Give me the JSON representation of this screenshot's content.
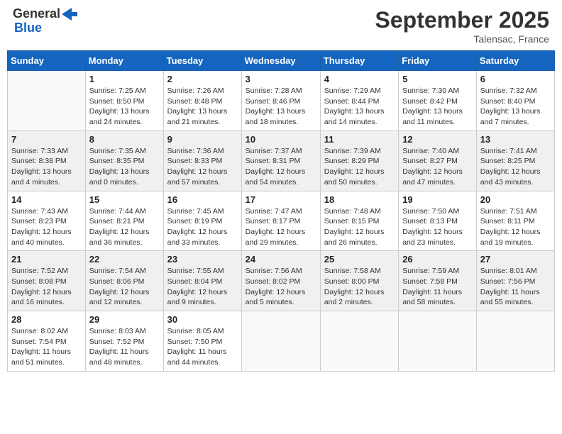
{
  "header": {
    "logo_general": "General",
    "logo_blue": "Blue",
    "title": "September 2025",
    "location": "Talensac, France"
  },
  "days_of_week": [
    "Sunday",
    "Monday",
    "Tuesday",
    "Wednesday",
    "Thursday",
    "Friday",
    "Saturday"
  ],
  "weeks": [
    [
      {
        "day": "",
        "info": ""
      },
      {
        "day": "1",
        "info": "Sunrise: 7:25 AM\nSunset: 8:50 PM\nDaylight: 13 hours\nand 24 minutes."
      },
      {
        "day": "2",
        "info": "Sunrise: 7:26 AM\nSunset: 8:48 PM\nDaylight: 13 hours\nand 21 minutes."
      },
      {
        "day": "3",
        "info": "Sunrise: 7:28 AM\nSunset: 8:46 PM\nDaylight: 13 hours\nand 18 minutes."
      },
      {
        "day": "4",
        "info": "Sunrise: 7:29 AM\nSunset: 8:44 PM\nDaylight: 13 hours\nand 14 minutes."
      },
      {
        "day": "5",
        "info": "Sunrise: 7:30 AM\nSunset: 8:42 PM\nDaylight: 13 hours\nand 11 minutes."
      },
      {
        "day": "6",
        "info": "Sunrise: 7:32 AM\nSunset: 8:40 PM\nDaylight: 13 hours\nand 7 minutes."
      }
    ],
    [
      {
        "day": "7",
        "info": "Sunrise: 7:33 AM\nSunset: 8:38 PM\nDaylight: 13 hours\nand 4 minutes."
      },
      {
        "day": "8",
        "info": "Sunrise: 7:35 AM\nSunset: 8:35 PM\nDaylight: 13 hours\nand 0 minutes."
      },
      {
        "day": "9",
        "info": "Sunrise: 7:36 AM\nSunset: 8:33 PM\nDaylight: 12 hours\nand 57 minutes."
      },
      {
        "day": "10",
        "info": "Sunrise: 7:37 AM\nSunset: 8:31 PM\nDaylight: 12 hours\nand 54 minutes."
      },
      {
        "day": "11",
        "info": "Sunrise: 7:39 AM\nSunset: 8:29 PM\nDaylight: 12 hours\nand 50 minutes."
      },
      {
        "day": "12",
        "info": "Sunrise: 7:40 AM\nSunset: 8:27 PM\nDaylight: 12 hours\nand 47 minutes."
      },
      {
        "day": "13",
        "info": "Sunrise: 7:41 AM\nSunset: 8:25 PM\nDaylight: 12 hours\nand 43 minutes."
      }
    ],
    [
      {
        "day": "14",
        "info": "Sunrise: 7:43 AM\nSunset: 8:23 PM\nDaylight: 12 hours\nand 40 minutes."
      },
      {
        "day": "15",
        "info": "Sunrise: 7:44 AM\nSunset: 8:21 PM\nDaylight: 12 hours\nand 36 minutes."
      },
      {
        "day": "16",
        "info": "Sunrise: 7:45 AM\nSunset: 8:19 PM\nDaylight: 12 hours\nand 33 minutes."
      },
      {
        "day": "17",
        "info": "Sunrise: 7:47 AM\nSunset: 8:17 PM\nDaylight: 12 hours\nand 29 minutes."
      },
      {
        "day": "18",
        "info": "Sunrise: 7:48 AM\nSunset: 8:15 PM\nDaylight: 12 hours\nand 26 minutes."
      },
      {
        "day": "19",
        "info": "Sunrise: 7:50 AM\nSunset: 8:13 PM\nDaylight: 12 hours\nand 23 minutes."
      },
      {
        "day": "20",
        "info": "Sunrise: 7:51 AM\nSunset: 8:11 PM\nDaylight: 12 hours\nand 19 minutes."
      }
    ],
    [
      {
        "day": "21",
        "info": "Sunrise: 7:52 AM\nSunset: 8:08 PM\nDaylight: 12 hours\nand 16 minutes."
      },
      {
        "day": "22",
        "info": "Sunrise: 7:54 AM\nSunset: 8:06 PM\nDaylight: 12 hours\nand 12 minutes."
      },
      {
        "day": "23",
        "info": "Sunrise: 7:55 AM\nSunset: 8:04 PM\nDaylight: 12 hours\nand 9 minutes."
      },
      {
        "day": "24",
        "info": "Sunrise: 7:56 AM\nSunset: 8:02 PM\nDaylight: 12 hours\nand 5 minutes."
      },
      {
        "day": "25",
        "info": "Sunrise: 7:58 AM\nSunset: 8:00 PM\nDaylight: 12 hours\nand 2 minutes."
      },
      {
        "day": "26",
        "info": "Sunrise: 7:59 AM\nSunset: 7:58 PM\nDaylight: 11 hours\nand 58 minutes."
      },
      {
        "day": "27",
        "info": "Sunrise: 8:01 AM\nSunset: 7:56 PM\nDaylight: 11 hours\nand 55 minutes."
      }
    ],
    [
      {
        "day": "28",
        "info": "Sunrise: 8:02 AM\nSunset: 7:54 PM\nDaylight: 11 hours\nand 51 minutes."
      },
      {
        "day": "29",
        "info": "Sunrise: 8:03 AM\nSunset: 7:52 PM\nDaylight: 11 hours\nand 48 minutes."
      },
      {
        "day": "30",
        "info": "Sunrise: 8:05 AM\nSunset: 7:50 PM\nDaylight: 11 hours\nand 44 minutes."
      },
      {
        "day": "",
        "info": ""
      },
      {
        "day": "",
        "info": ""
      },
      {
        "day": "",
        "info": ""
      },
      {
        "day": "",
        "info": ""
      }
    ]
  ]
}
